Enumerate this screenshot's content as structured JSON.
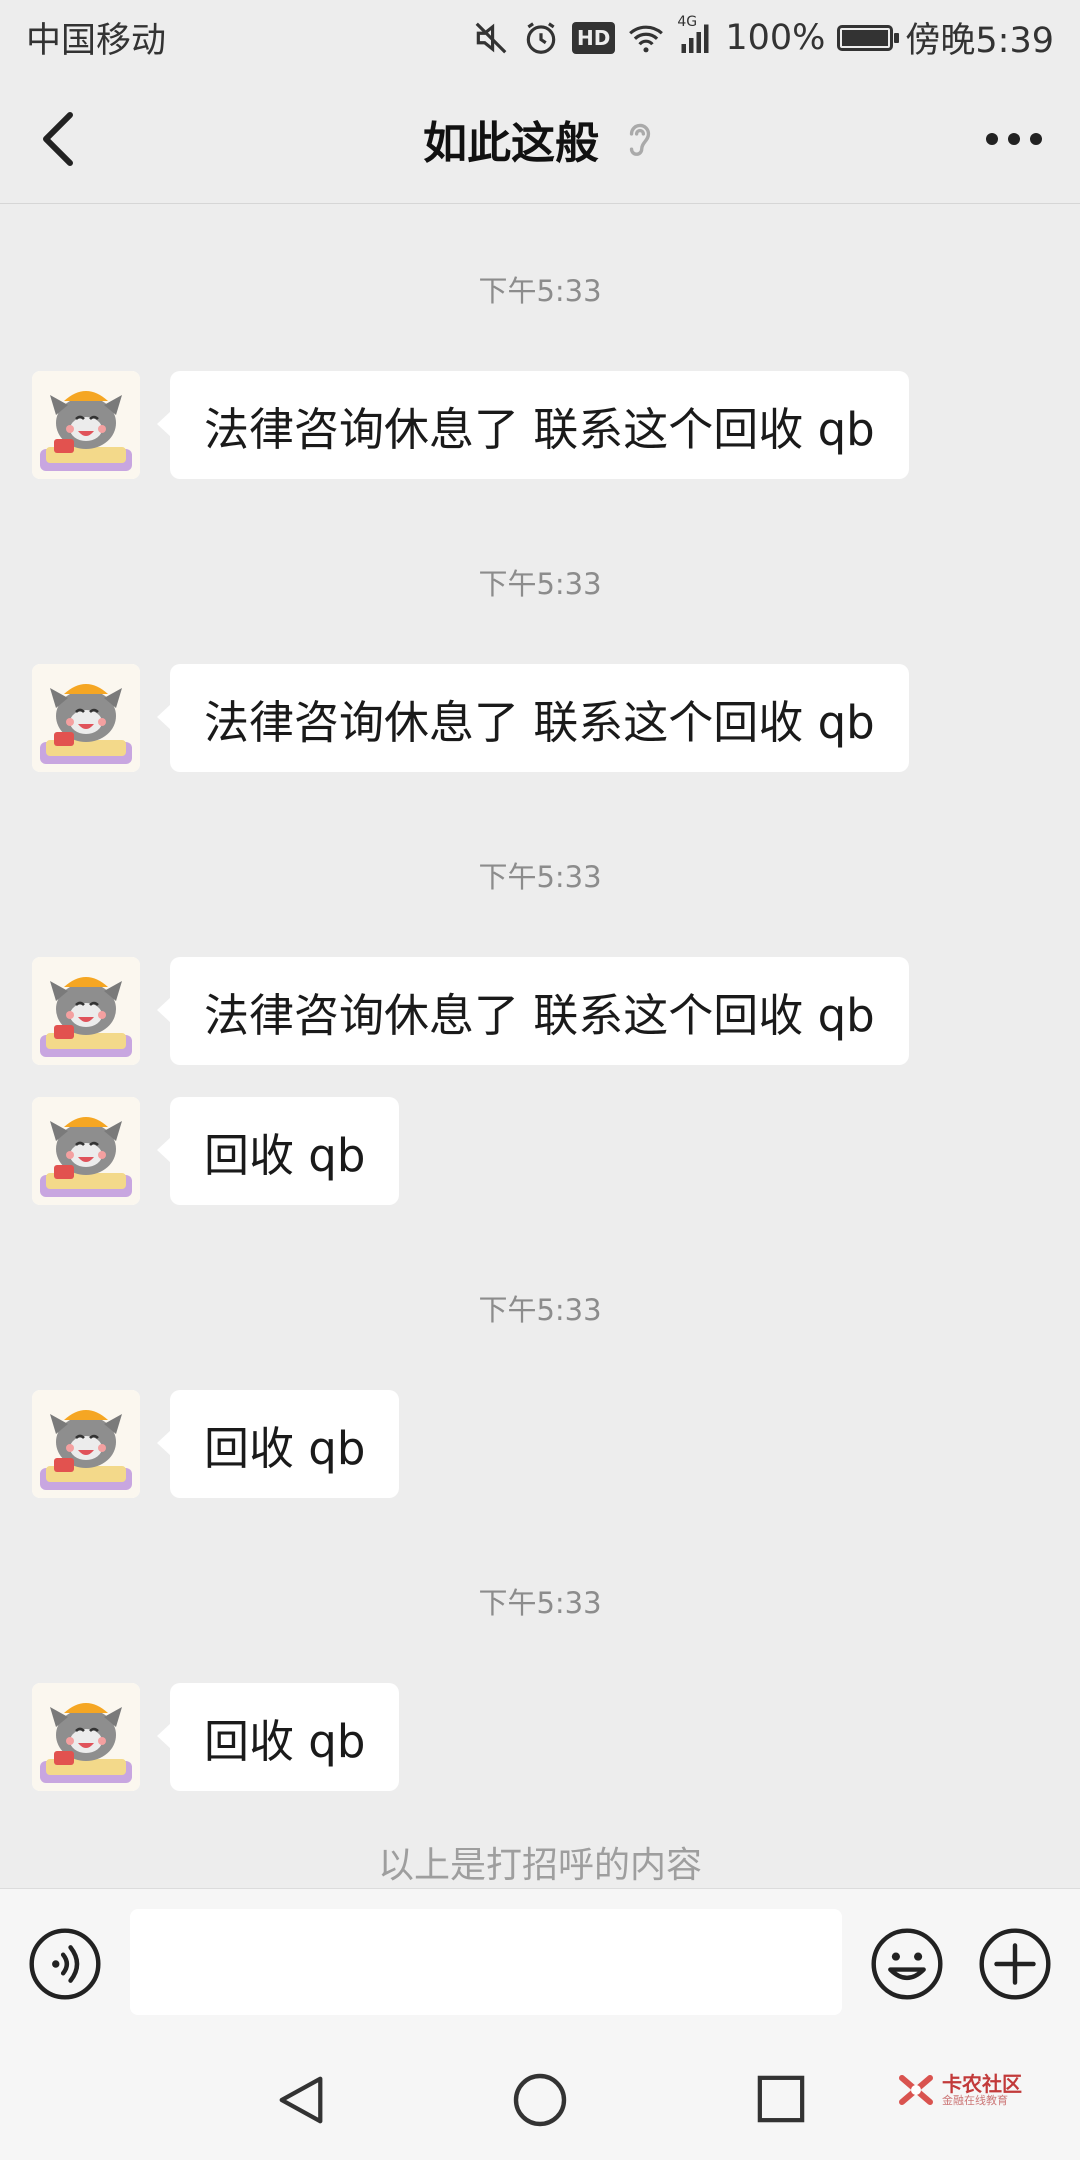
{
  "status_bar": {
    "carrier": "中国移动",
    "hd_badge": "HD",
    "network": "4G",
    "battery": "100%",
    "time": "傍晚5:39",
    "icons": [
      "mute-icon",
      "alarm-icon",
      "hd-icon",
      "wifi-icon",
      "signal-icon",
      "battery-icon"
    ]
  },
  "header": {
    "title": "如此这般",
    "back_icon": "chevron-left-icon",
    "ear_icon": "ear-icon",
    "more_icon": "more-dots-icon"
  },
  "messages": [
    {
      "timestamp": "下午5:33",
      "text": "法律咨询休息了 联系这个回收 qb"
    },
    {
      "timestamp": "下午5:33",
      "text": "法律咨询休息了 联系这个回收 qb"
    },
    {
      "timestamp": "下午5:33",
      "text": "法律咨询休息了 联系这个回收 qb"
    },
    {
      "timestamp": "",
      "text": "回收 qb"
    },
    {
      "timestamp": "下午5:33",
      "text": "回收 qb"
    },
    {
      "timestamp": "下午5:33",
      "text": "回收 qb"
    }
  ],
  "hint": "以上是打招呼的内容",
  "input_bar": {
    "placeholder": "",
    "voice_icon": "voice-icon",
    "emoji_icon": "emoji-icon",
    "plus_icon": "plus-circle-icon"
  },
  "system_nav": {
    "icons": [
      "nav-back-icon",
      "nav-home-icon",
      "nav-recent-icon"
    ]
  },
  "watermark": {
    "title": "卡农社区",
    "subtitle": "金融在线教育"
  },
  "colors": {
    "background": "#ededed",
    "bubble": "#ffffff",
    "text": "#1a1a1a",
    "timestamp": "#8c8c8c"
  }
}
